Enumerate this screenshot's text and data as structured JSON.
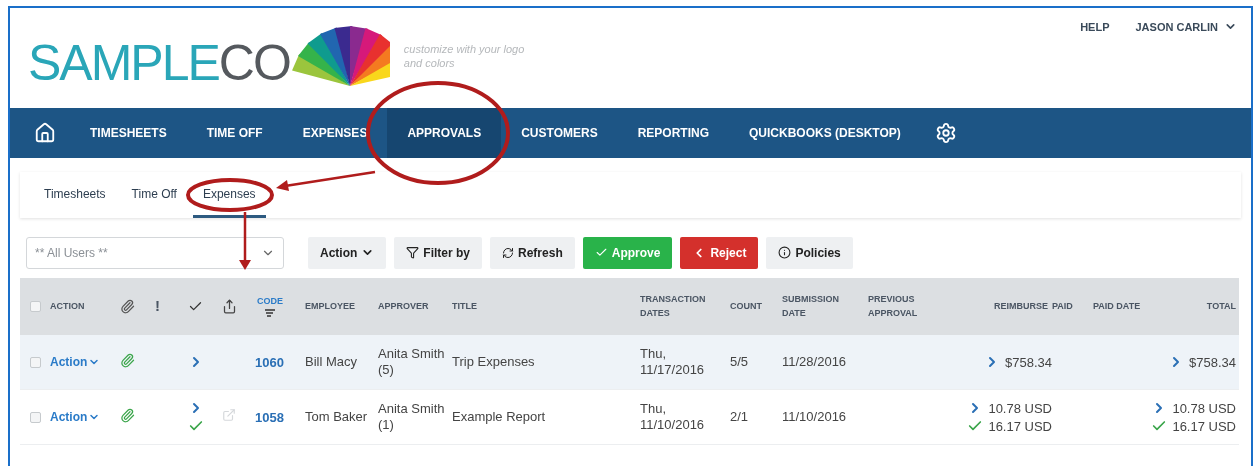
{
  "logo": {
    "parts": [
      {
        "text": "SAMPLE",
        "color": "#2aa6b8"
      },
      {
        "text": "CO",
        "color": "#55595e"
      }
    ],
    "tagline": "customize with your logo and colors"
  },
  "top_links": [
    {
      "label": "HELP",
      "dropdown": false
    },
    {
      "label": "JASON CARLIN",
      "dropdown": true
    }
  ],
  "nav": [
    {
      "kind": "home",
      "selected": false
    },
    {
      "kind": "text",
      "label": "TIMESHEETS",
      "selected": false
    },
    {
      "kind": "text",
      "label": "TIME OFF",
      "selected": false
    },
    {
      "kind": "text",
      "label": "EXPENSES",
      "selected": false
    },
    {
      "kind": "text",
      "label": "APPROVALS",
      "selected": true
    },
    {
      "kind": "text",
      "label": "CUSTOMERS",
      "selected": false
    },
    {
      "kind": "text",
      "label": "REPORTING",
      "selected": false
    },
    {
      "kind": "text",
      "label": "QUICKBOOKS (DESKTOP)",
      "selected": false
    },
    {
      "kind": "settings",
      "selected": false
    }
  ],
  "subtabs": [
    {
      "label": "Timesheets",
      "selected": false
    },
    {
      "label": "Time Off",
      "selected": false
    },
    {
      "label": "Expenses",
      "selected": true
    }
  ],
  "toolbar": {
    "user_select": {
      "value": "** All Users **"
    },
    "buttons": [
      {
        "kind": "dropdown",
        "label": "Action"
      },
      {
        "kind": "filter",
        "label": "Filter by"
      },
      {
        "kind": "refresh",
        "label": "Refresh"
      },
      {
        "kind": "approve",
        "label": "Approve"
      },
      {
        "kind": "reject",
        "label": "Reject"
      },
      {
        "kind": "info",
        "label": "Policies"
      }
    ]
  },
  "table": {
    "columns": [
      {
        "kind": "checkbox",
        "checked": false
      },
      {
        "kind": "text",
        "label": "ACTION"
      },
      {
        "kind": "attachment"
      },
      {
        "kind": "text",
        "label": "!"
      },
      {
        "kind": "approved"
      },
      {
        "kind": "export"
      },
      {
        "kind": "sort",
        "label": "CODE"
      },
      {
        "kind": "text",
        "label": "EMPLOYEE"
      },
      {
        "kind": "text",
        "label": "APPROVER"
      },
      {
        "kind": "text",
        "label": "TITLE"
      },
      {
        "kind": "text",
        "label": "TRANSACTION DATES"
      },
      {
        "kind": "text",
        "label": "COUNT"
      },
      {
        "kind": "text",
        "label": "SUBMISSION DATE"
      },
      {
        "kind": "text",
        "label": "PREVIOUS APPROVAL"
      },
      {
        "kind": "text",
        "label": "REIMBURSE"
      },
      {
        "kind": "text",
        "label": "PAID"
      },
      {
        "kind": "text",
        "label": "PAID DATE"
      },
      {
        "kind": "text",
        "label": "TOTAL"
      }
    ],
    "rows": [
      {
        "checked": false,
        "action": "Action",
        "attachment": true,
        "marks": [
          {
            "kind": "forward"
          }
        ],
        "export": false,
        "code": "1060",
        "employee": "Bill Macy",
        "approver": "Anita Smith (5)",
        "title": "Trip Expenses",
        "transaction_dates": "Thu, 11/17/2016",
        "count": "5/5",
        "submission_date": "11/28/2016",
        "reimburse": [
          {
            "kind": "forward",
            "amount": "$758.34"
          }
        ],
        "total": [
          {
            "kind": "forward",
            "amount": "$758.34"
          }
        ]
      },
      {
        "checked": false,
        "action": "Action",
        "attachment": true,
        "marks": [
          {
            "kind": "forward"
          },
          {
            "kind": "approved"
          }
        ],
        "export": true,
        "code": "1058",
        "employee": "Tom Baker",
        "approver": "Anita Smith (1)",
        "title": "Example Report",
        "transaction_dates": "Thu, 11/10/2016",
        "count": "2/1",
        "submission_date": "11/10/2016",
        "reimburse": [
          {
            "kind": "forward",
            "amount": "10.78 USD"
          },
          {
            "kind": "approved",
            "amount": "16.17 USD"
          }
        ],
        "total": [
          {
            "kind": "forward",
            "amount": "10.78 USD"
          },
          {
            "kind": "approved",
            "amount": "16.17 USD"
          }
        ]
      }
    ]
  }
}
